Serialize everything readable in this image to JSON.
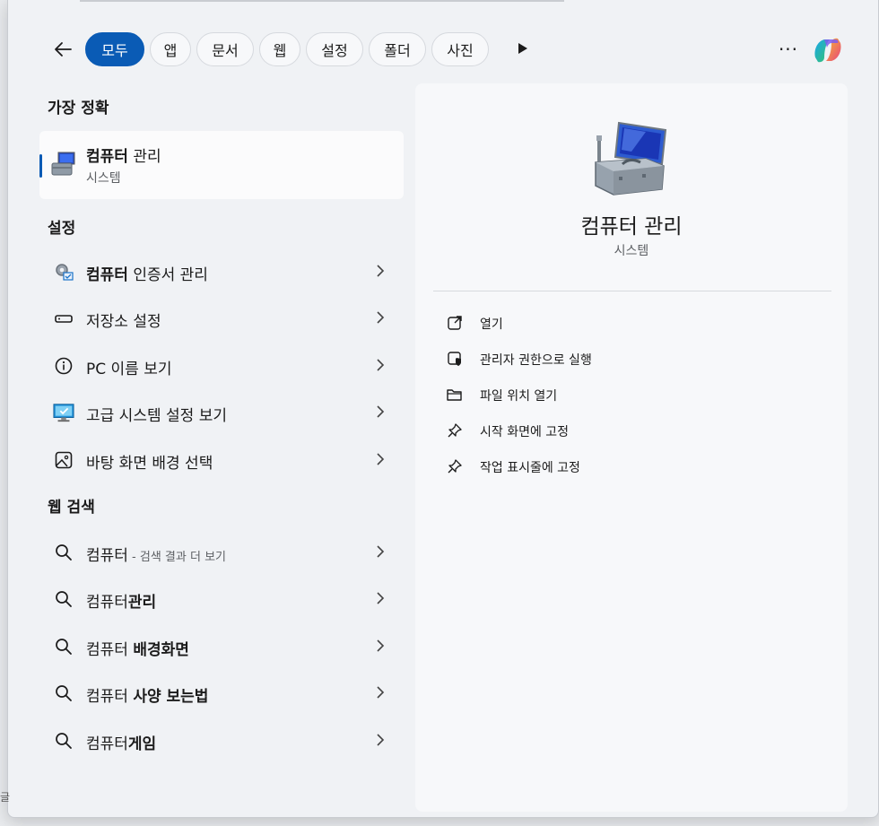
{
  "filters": {
    "tabs": [
      {
        "label": "모두"
      },
      {
        "label": "앱"
      },
      {
        "label": "문서"
      },
      {
        "label": "웹"
      },
      {
        "label": "설정"
      },
      {
        "label": "폴더"
      },
      {
        "label": "사진"
      }
    ],
    "more_label": "···"
  },
  "best_match": {
    "section_title": "가장 정확",
    "title_bold": "컴퓨터",
    "title_rest": " 관리",
    "subtitle": "시스템"
  },
  "settings": {
    "section_title": "설정",
    "items": [
      {
        "bold": "컴퓨터",
        "rest": " 인증서 관리",
        "icon": "certificate-gear-icon"
      },
      {
        "bold": "",
        "rest": "저장소 설정",
        "icon": "storage-drive-icon"
      },
      {
        "bold": "",
        "rest": "PC 이름 보기",
        "icon": "info-icon"
      },
      {
        "bold": "",
        "rest": "고급 시스템 설정 보기",
        "icon": "monitor-check-icon"
      },
      {
        "bold": "",
        "rest": "바탕 화면 배경 선택",
        "icon": "image-icon"
      }
    ]
  },
  "web": {
    "section_title": "웹 검색",
    "items": [
      {
        "pre": "컴퓨터",
        "bold": "",
        "sub": " - 검색 결과 더 보기"
      },
      {
        "pre": "컴퓨터",
        "bold": "관리",
        "sub": ""
      },
      {
        "pre": "컴퓨터 ",
        "bold": "배경화면",
        "sub": ""
      },
      {
        "pre": "컴퓨터 ",
        "bold": "사양 보는법",
        "sub": ""
      },
      {
        "pre": "컴퓨터",
        "bold": "게임",
        "sub": ""
      }
    ]
  },
  "preview": {
    "title": "컴퓨터 관리",
    "subtitle": "시스템",
    "actions": [
      {
        "label": "열기",
        "icon": "open-external-icon"
      },
      {
        "label": "관리자 권한으로 실행",
        "icon": "admin-shield-icon"
      },
      {
        "label": "파일 위치 열기",
        "icon": "folder-icon"
      },
      {
        "label": "시작 화면에 고정",
        "icon": "pin-icon"
      },
      {
        "label": "작업 표시줄에 고정",
        "icon": "pin-icon"
      }
    ]
  },
  "edge_char": "글",
  "colors": {
    "accent": "#0a5bb5",
    "panel": "#f0f2f5",
    "preview": "#f7f8fa"
  }
}
